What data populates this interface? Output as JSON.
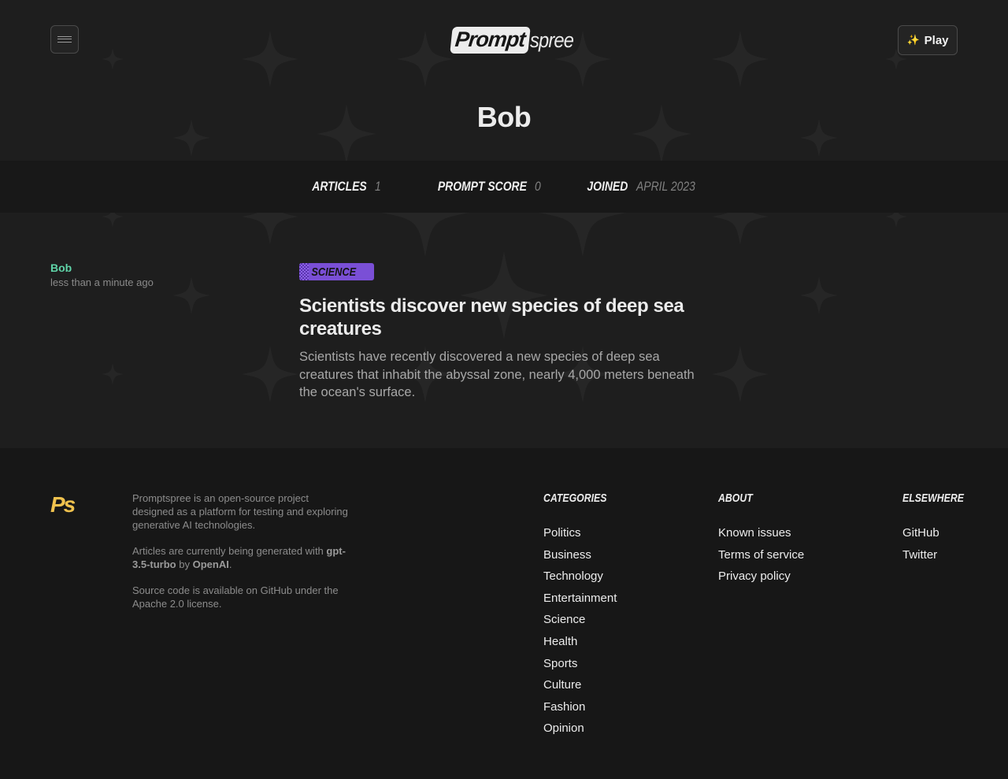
{
  "header": {
    "logo_part1": "Prompt",
    "logo_part2": "spree",
    "play_label": "Play",
    "play_icon": "sparkles-icon",
    "menu_icon": "hamburger-icon"
  },
  "profile": {
    "name": "Bob",
    "stats": [
      {
        "label": "Articles",
        "value": "1"
      },
      {
        "label": "Prompt score",
        "value": "0"
      },
      {
        "label": "Joined",
        "value": "April 2023"
      }
    ]
  },
  "article": {
    "author": "Bob",
    "time_ago": "less than a minute ago",
    "category": "Science",
    "title": "Scientists discover new species of deep sea creatures",
    "excerpt": "Scientists have recently discovered a new species of deep sea creatures that inhabit the abyssal zone, nearly 4,000 meters beneath the ocean's surface."
  },
  "footer": {
    "logo": "Ps",
    "about_1": "Promptspree is an open-source project designed as a platform for testing and exploring generative AI technologies.",
    "about_2_prefix": "Articles are currently being generated with",
    "about_2_model": "gpt-3.5-turbo",
    "about_2_by": "by",
    "about_2_org": "OpenAI",
    "about_3": "Source code is available on GitHub under the Apache 2.0 license.",
    "categories_heading": "Categories",
    "categories": [
      "Politics",
      "Business",
      "Technology",
      "Entertainment",
      "Science",
      "Health",
      "Sports",
      "Culture",
      "Fashion",
      "Opinion"
    ],
    "about_heading": "About",
    "about_links": [
      "Known issues",
      "Terms of service",
      "Privacy policy"
    ],
    "elsewhere_heading": "Elsewhere",
    "elsewhere_links": [
      "GitHub",
      "Twitter"
    ]
  },
  "colors": {
    "background": "#1e1e1e",
    "accent_author": "#5fd4a8",
    "tag_purple": "#7a4fd6",
    "logo_yellow": "#f0c24e"
  }
}
